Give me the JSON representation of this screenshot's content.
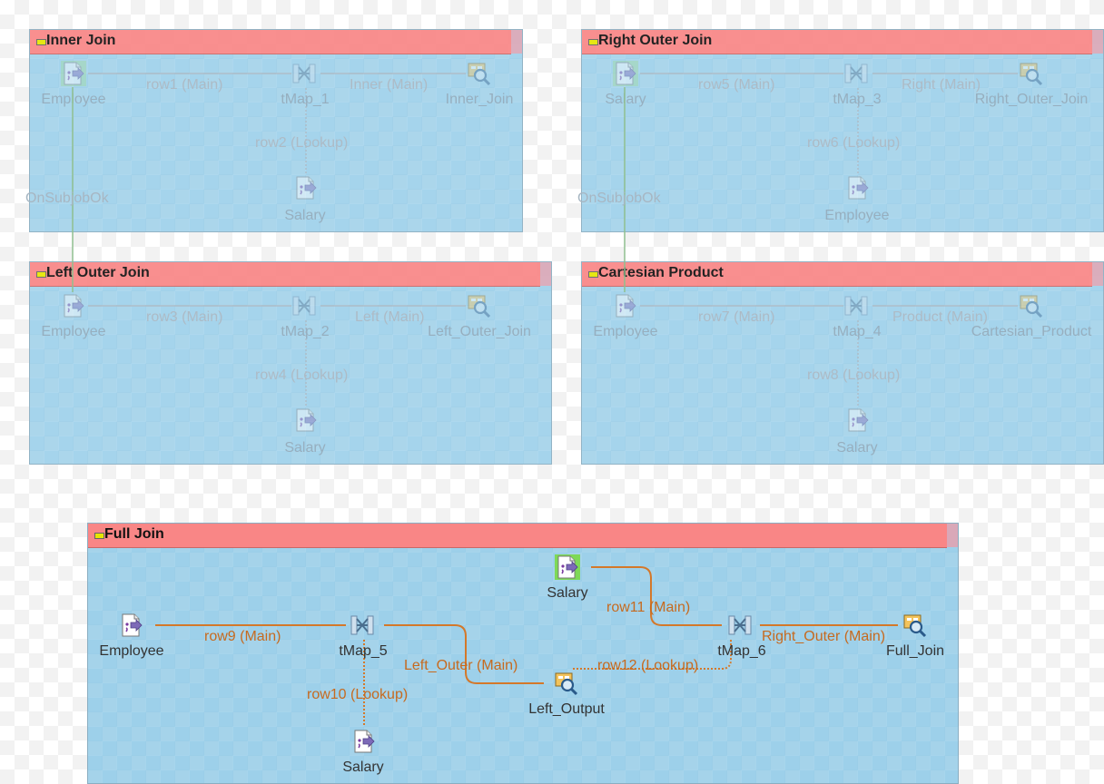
{
  "subjobs": [
    {
      "title": "Inner Join",
      "nodes": {
        "input": "Employee",
        "map": "tMap_1",
        "output": "Inner_Join",
        "lookup": "Salary"
      },
      "links": {
        "main": "row1 (Main)",
        "out": "Inner (Main)",
        "lookup": "row2 (Lookup)"
      }
    },
    {
      "title": "Right Outer Join",
      "nodes": {
        "input": "Salary",
        "map": "tMap_3",
        "output": "Right_Outer_Join",
        "lookup": "Employee"
      },
      "links": {
        "main": "row5 (Main)",
        "out": "Right (Main)",
        "lookup": "row6 (Lookup)"
      }
    },
    {
      "title": "Left Outer Join",
      "nodes": {
        "input": "Employee",
        "map": "tMap_2",
        "output": "Left_Outer_Join",
        "lookup": "Salary"
      },
      "links": {
        "main": "row3 (Main)",
        "out": "Left (Main)",
        "lookup": "row4 (Lookup)"
      }
    },
    {
      "title": "Cartesian Product",
      "nodes": {
        "input": "Employee",
        "map": "tMap_4",
        "output": "Cartesian_Product",
        "lookup": "Salary"
      },
      "links": {
        "main": "row7 (Main)",
        "out": "Product (Main)",
        "lookup": "row8 (Lookup)"
      }
    }
  ],
  "triggers": [
    "OnSubjobOk",
    "OnSubjobOk"
  ],
  "full_join": {
    "title": "Full Join",
    "nodes": {
      "employee": "Employee",
      "salary_top": "Salary",
      "tmap5": "tMap_5",
      "tmap6": "tMap_6",
      "left_output": "Left_Output",
      "full_join": "Full_Join",
      "salary_bottom": "Salary"
    },
    "links": {
      "row9": "row9 (Main)",
      "row10": "row10 (Lookup)",
      "row11": "row11 (Main)",
      "row12": "row12 (Lookup)",
      "left_outer": "Left_Outer (Main)",
      "right_outer": "Right_Outer (Main)"
    }
  },
  "colors": {
    "subjob_bg": "#8cc8e6",
    "header": "#f98686",
    "link_active": "#d4782a",
    "link_faded": "#a8b8c4"
  },
  "icons": {
    "input": "file-input-icon",
    "map": "tmap-icon",
    "output": "log-row-icon"
  }
}
